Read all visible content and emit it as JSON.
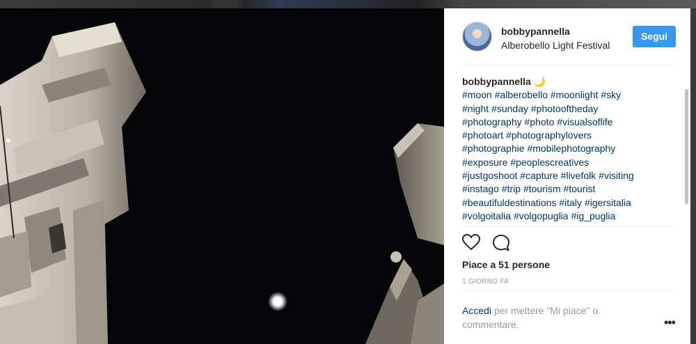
{
  "post": {
    "username": "bobbypannella",
    "location": "Alberobello Light Festival",
    "follow_label": "Segui",
    "caption_username": "bobbypannella",
    "caption_emoji": "🌙",
    "hashtags": [
      "#moon",
      "#alberobello",
      "#moonlight",
      "#sky",
      "#night",
      "#sunday",
      "#photooftheday",
      "#photography",
      "#photo",
      "#visualsoflife",
      "#photoart",
      "#photographylovers",
      "#photographie",
      "#mobilephotography",
      "#exposure",
      "#peoplescreatives",
      "#justgoshoot",
      "#capture",
      "#livefolk",
      "#visiting",
      "#instago",
      "#trip",
      "#tourism",
      "#tourist",
      "#beautifuldestinations",
      "#italy",
      "#igersitalia",
      "#volgoitalia",
      "#volgopuglia",
      "#ig_puglia"
    ],
    "hashtag_lines": [
      [
        0,
        4
      ],
      [
        4,
        7
      ],
      [
        7,
        10
      ],
      [
        10,
        12
      ],
      [
        12,
        14
      ],
      [
        14,
        16
      ],
      [
        16,
        20
      ],
      [
        20,
        24
      ],
      [
        24,
        27
      ],
      [
        27,
        30
      ]
    ],
    "likes_text": "Piace a 51 persone",
    "time_text": "1 GIORNO FA",
    "comment": {
      "login_link": "Accedi",
      "rest": " per mettere \"Mi piace\" o commentare."
    },
    "more_label": "•••"
  },
  "icons": {
    "like": "heart-icon",
    "comment": "comment-bubble-icon",
    "more": "more-options-icon"
  },
  "colors": {
    "follow_button": "#3897f0",
    "hashtag": "#003569",
    "muted": "#999999",
    "photo_bg": "#050507"
  }
}
